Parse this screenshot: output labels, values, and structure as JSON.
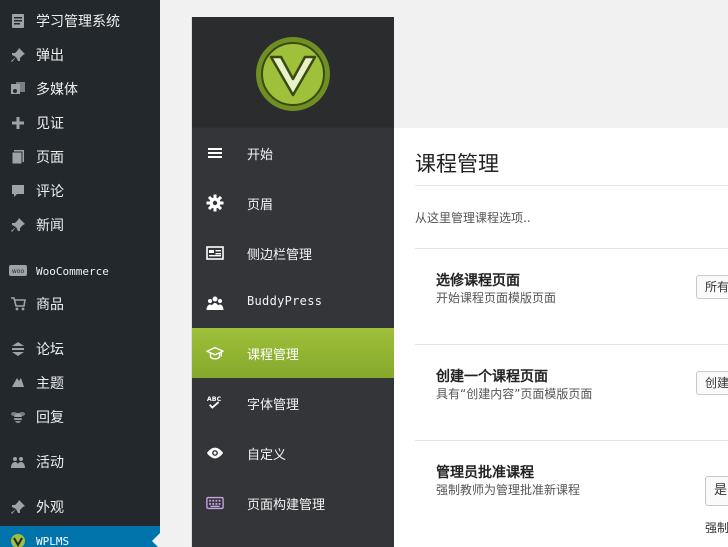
{
  "wp_menu": [
    {
      "label": "学习管理系统",
      "icon": "clipboard-icon"
    },
    {
      "label": "弹出",
      "icon": "pin-icon"
    },
    {
      "label": "多媒体",
      "icon": "media-icon"
    },
    {
      "label": "见证",
      "icon": "plus-icon"
    },
    {
      "label": "页面",
      "icon": "pages-icon"
    },
    {
      "label": "评论",
      "icon": "comment-icon"
    },
    {
      "label": "新闻",
      "icon": "pin-icon"
    },
    {
      "label": "WooCommerce",
      "icon": "woo-icon"
    },
    {
      "label": "商品",
      "icon": "cart-icon"
    },
    {
      "label": "论坛",
      "icon": "forum-icon"
    },
    {
      "label": "主题",
      "icon": "topic-icon"
    },
    {
      "label": "回复",
      "icon": "bee-icon"
    },
    {
      "label": "活动",
      "icon": "activity-icon"
    },
    {
      "label": "外观",
      "icon": "pin-icon"
    },
    {
      "label": "WPLMS",
      "icon": "wplms-icon"
    }
  ],
  "panel_nav": [
    {
      "label": "开始",
      "icon": "menu-lines-icon"
    },
    {
      "label": "页眉",
      "icon": "gear-icon"
    },
    {
      "label": "侧边栏管理",
      "icon": "sidebar-icon"
    },
    {
      "label": "BuddyPress",
      "icon": "people-icon"
    },
    {
      "label": "课程管理",
      "icon": "graduation-cap-icon"
    },
    {
      "label": "字体管理",
      "icon": "spellcheck-icon"
    },
    {
      "label": "自定义",
      "icon": "eye-icon"
    },
    {
      "label": "页面构建管理",
      "icon": "keyboard-icon"
    }
  ],
  "content": {
    "title": "课程管理",
    "description": "从这里管理课程选项..",
    "options": [
      {
        "title": "选修课程页面",
        "desc": "开始课程页面模版页面",
        "control": "所有"
      },
      {
        "title": "创建一个课程页面",
        "desc": "具有“创建内容”页面模版页面",
        "control": "创建"
      },
      {
        "title": "管理员批准课程",
        "desc": "强制教师为管理批准新课程",
        "control": "是",
        "note": "强制"
      }
    ]
  },
  "colors": {
    "accent": "#8fb331",
    "wp_active": "#0073aa",
    "sidebar_bg": "#23282d"
  }
}
